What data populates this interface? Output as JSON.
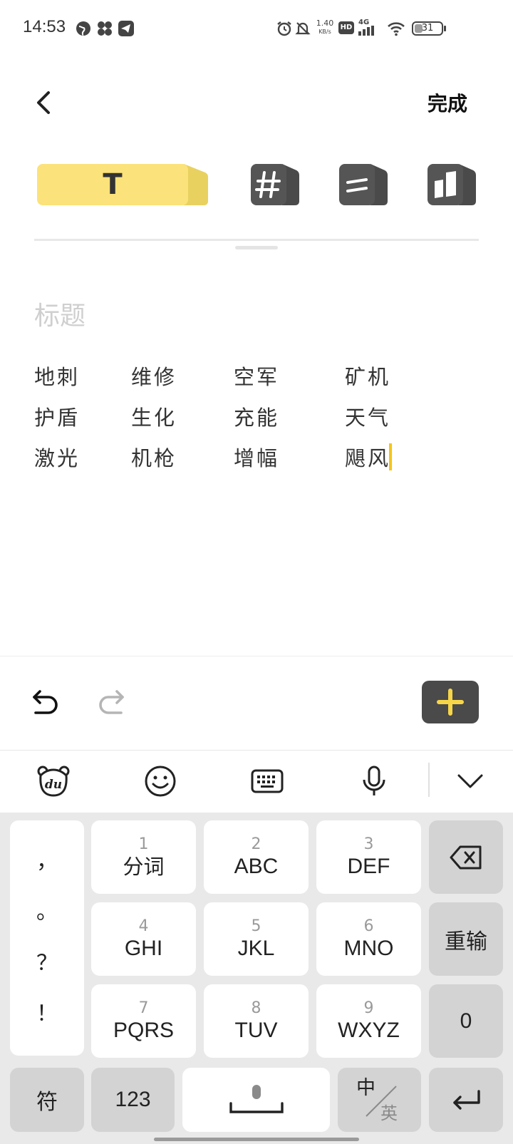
{
  "status_bar": {
    "time": "14:53",
    "speed": "1.40",
    "speed_unit": "KB/s",
    "hd": "HD",
    "network": "4G",
    "battery": "31",
    "battery_percent": 31
  },
  "header": {
    "back_icon": "chevron-left-icon",
    "done_label": "完成"
  },
  "note_types": {
    "text_label": "T",
    "selected": "text",
    "accent_color": "#fbe27a",
    "items": [
      "text-icon",
      "hashtag-icon",
      "list-icon",
      "grid-icon"
    ]
  },
  "editor": {
    "title_placeholder": "标题",
    "lines": [
      [
        "地刺",
        "维修",
        "空军",
        "矿机"
      ],
      [
        "护盾",
        "生化",
        "充能",
        "天气"
      ],
      [
        "激光",
        "机枪",
        "增幅",
        "飓风"
      ]
    ]
  },
  "toolbar": {
    "undo_icon": "undo-icon",
    "redo_icon": "redo-icon",
    "add_icon": "plus-icon",
    "add_color": "#f7d548"
  },
  "ime_toolbar": {
    "icons": [
      "du-bear-logo-icon",
      "emoji-icon",
      "keyboard-icon",
      "microphone-icon",
      "chevron-down-icon"
    ]
  },
  "keyboard": {
    "punctuation": [
      "，",
      "。",
      "？",
      "！"
    ],
    "keys": [
      {
        "num": "1",
        "letters": "分词"
      },
      {
        "num": "2",
        "letters": "ABC"
      },
      {
        "num": "3",
        "letters": "DEF"
      },
      {
        "num": "4",
        "letters": "GHI"
      },
      {
        "num": "5",
        "letters": "JKL"
      },
      {
        "num": "6",
        "letters": "MNO"
      },
      {
        "num": "7",
        "letters": "PQRS"
      },
      {
        "num": "8",
        "letters": "TUV"
      },
      {
        "num": "9",
        "letters": "WXYZ"
      }
    ],
    "reenter_label": "重输",
    "zero_label": "0",
    "symbols_label": "符",
    "numbers_label": "123",
    "lang_cn": "中",
    "lang_en": "英"
  }
}
